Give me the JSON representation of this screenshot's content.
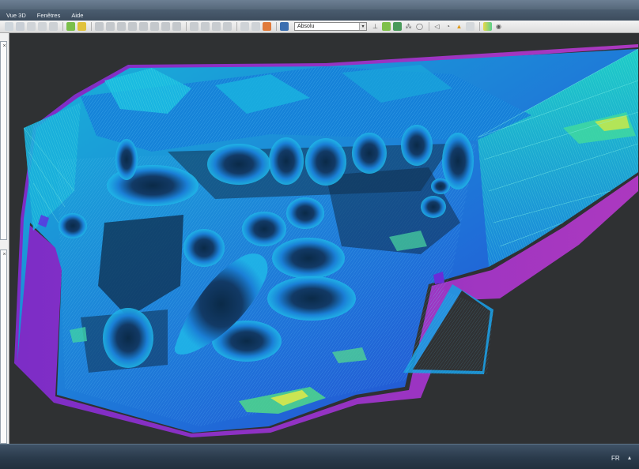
{
  "menu": [
    "Vue 3D",
    "Fenêtres",
    "Aide"
  ],
  "toolbar": {
    "mode_select_value": "Absolu",
    "icons": [
      "open-icon",
      "save-icon",
      "undo-icon",
      "redo-icon",
      "cut-icon",
      "copy-icon",
      "paste-icon",
      "select-icon",
      "lasso-icon",
      "view-front-icon",
      "view-back-icon",
      "view-left-icon",
      "view-right-icon",
      "view-top-icon",
      "view-bottom-icon",
      "rotate-icon",
      "pan-icon",
      "zoom-icon",
      "zoom-fit-icon",
      "layers-icon",
      "measure-icon",
      "screen-icon",
      "axes-icon",
      "point-cloud-icon",
      "mesh-icon",
      "scale-icon",
      "cone-icon",
      "light-icon",
      "warning-icon",
      "color-ramp-icon",
      "eye-icon"
    ]
  },
  "colors": {
    "viewport_bg": "#2f3133",
    "ramp": [
      "#3a1fd6",
      "#1566e0",
      "#19a8e8",
      "#1fd6c8",
      "#5ee07a",
      "#d8e84a"
    ],
    "mesh_line": "#6fd9ff"
  },
  "taskbar": {
    "language": "FR"
  }
}
